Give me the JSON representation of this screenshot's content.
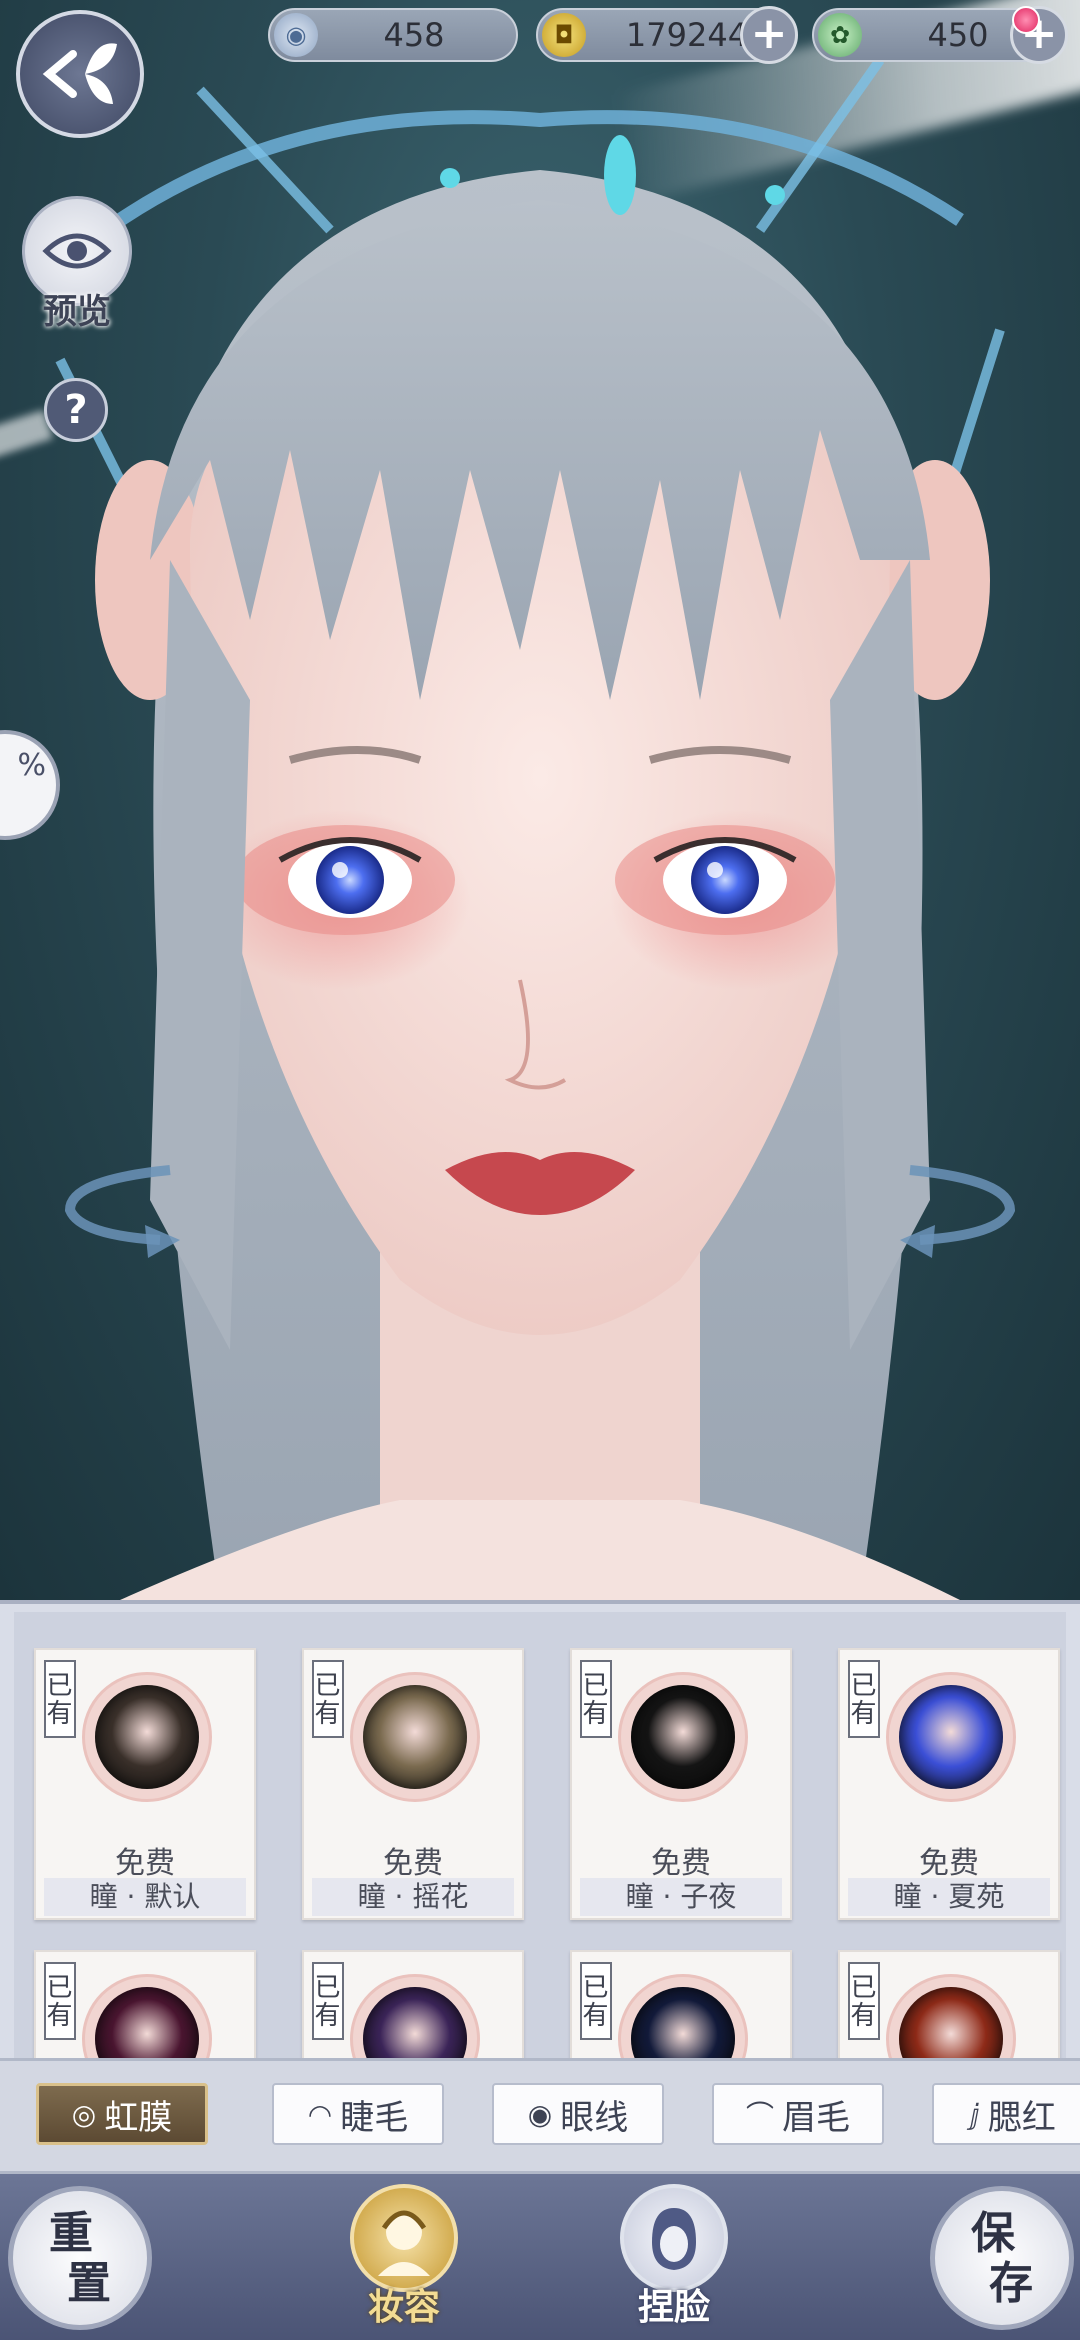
{
  "currencies": {
    "jade": {
      "value": "458",
      "icon": "jade-coin-icon"
    },
    "coin": {
      "value": "179244",
      "icon": "copper-coin-icon"
    },
    "ticket": {
      "value": "450",
      "icon": "ticket-icon"
    }
  },
  "left_tools": {
    "preview_label": "预览",
    "help_label": "?",
    "progress_label": "%"
  },
  "items": [
    {
      "owned": "已有",
      "price": "免费",
      "name": "瞳 · 默认",
      "color": "#3a302a"
    },
    {
      "owned": "已有",
      "price": "免费",
      "name": "瞳 · 摇花",
      "color": "#7a6a4f"
    },
    {
      "owned": "已有",
      "price": "免费",
      "name": "瞳 · 子夜",
      "color": "#141414"
    },
    {
      "owned": "已有",
      "price": "免费",
      "name": "瞳 · 夏苑",
      "color": "#3b4fd6"
    },
    {
      "owned": "已有",
      "color": "#4a1530"
    },
    {
      "owned": "已有",
      "color": "#3b2458"
    },
    {
      "owned": "已有",
      "color": "#121a3a"
    },
    {
      "owned": "已有",
      "color": "#8e2a18"
    }
  ],
  "tabs": [
    {
      "label": "虹膜",
      "icon": "iris-icon",
      "active": true
    },
    {
      "label": "睫毛",
      "icon": "eyelash-icon",
      "active": false
    },
    {
      "label": "眼线",
      "icon": "eye-icon",
      "active": false
    },
    {
      "label": "眉毛",
      "icon": "eyebrow-icon",
      "active": false
    },
    {
      "label": "腮红",
      "icon": "blush-icon",
      "active": false
    }
  ],
  "nav": {
    "reset_label": "重置",
    "makeup_label": "妆容",
    "face_label": "捏脸",
    "save_label": "保存"
  },
  "colors": {
    "panel_bg": "#d9dde8",
    "active_tab": "#6e5b3f",
    "accent_gold": "#d9c08a",
    "nav_bg": "#5b6486"
  }
}
